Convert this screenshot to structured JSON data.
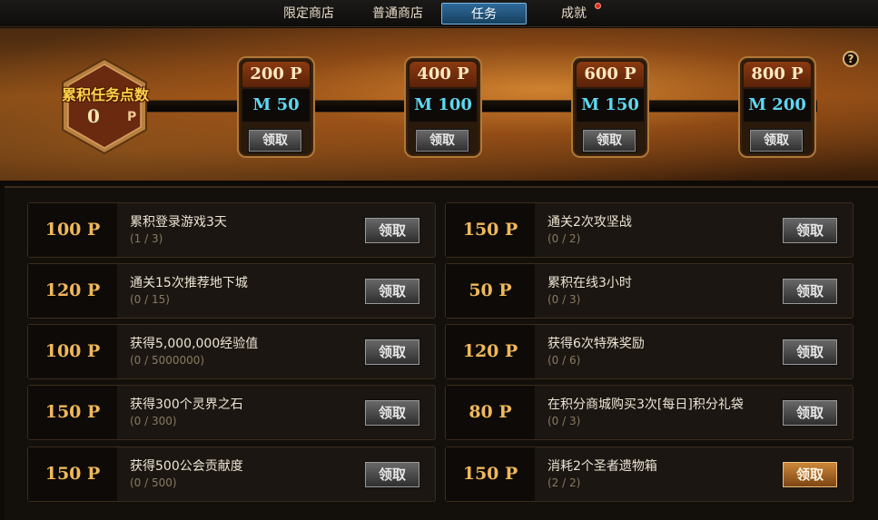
{
  "tabs": [
    {
      "label": "限定商店"
    },
    {
      "label": "普通商店"
    },
    {
      "label": "任务"
    },
    {
      "label": "成就"
    }
  ],
  "header": {
    "title": "累积任务点数",
    "points": "0",
    "points_unit": "P",
    "help_icon": "?"
  },
  "milestones": [
    {
      "points": "200 P",
      "reward": "M 50",
      "button": "领取"
    },
    {
      "points": "400 P",
      "reward": "M 100",
      "button": "领取"
    },
    {
      "points": "600 P",
      "reward": "M 150",
      "button": "领取"
    },
    {
      "points": "800 P",
      "reward": "M 200",
      "button": "领取"
    }
  ],
  "tasks": [
    {
      "points": "100 P",
      "title": "累积登录游戏3天",
      "progress": "(1 / 3)",
      "button": "领取"
    },
    {
      "points": "150 P",
      "title": "通关2次攻坚战",
      "progress": "(0 / 2)",
      "button": "领取"
    },
    {
      "points": "120 P",
      "title": "通关15次推荐地下城",
      "progress": "(0 / 15)",
      "button": "领取"
    },
    {
      "points": "50 P",
      "title": "累积在线3小时",
      "progress": "(0 / 3)",
      "button": "领取"
    },
    {
      "points": "100 P",
      "title": "获得5,000,000经验值",
      "progress": "(0 / 5000000)",
      "button": "领取"
    },
    {
      "points": "120 P",
      "title": "获得6次特殊奖励",
      "progress": "(0 / 6)",
      "button": "领取"
    },
    {
      "points": "150 P",
      "title": "获得300个灵界之石",
      "progress": "(0 / 300)",
      "button": "领取"
    },
    {
      "points": "80 P",
      "title": "在积分商城购买3次[每日]积分礼袋",
      "progress": "(0 / 3)",
      "button": "领取"
    },
    {
      "points": "150 P",
      "title": "获得500公会贡献度",
      "progress": "(0 / 500)",
      "button": "领取"
    },
    {
      "points": "150 P",
      "title": "消耗2个圣者遗物箱",
      "progress": "(2 / 2)",
      "button": "领取"
    }
  ],
  "colors": {
    "accent_tab": "#2e6a9a",
    "points_gold": "#f0b85a",
    "reward_cyan": "#5ed8f0",
    "claim_enabled": "#d08a3a"
  }
}
